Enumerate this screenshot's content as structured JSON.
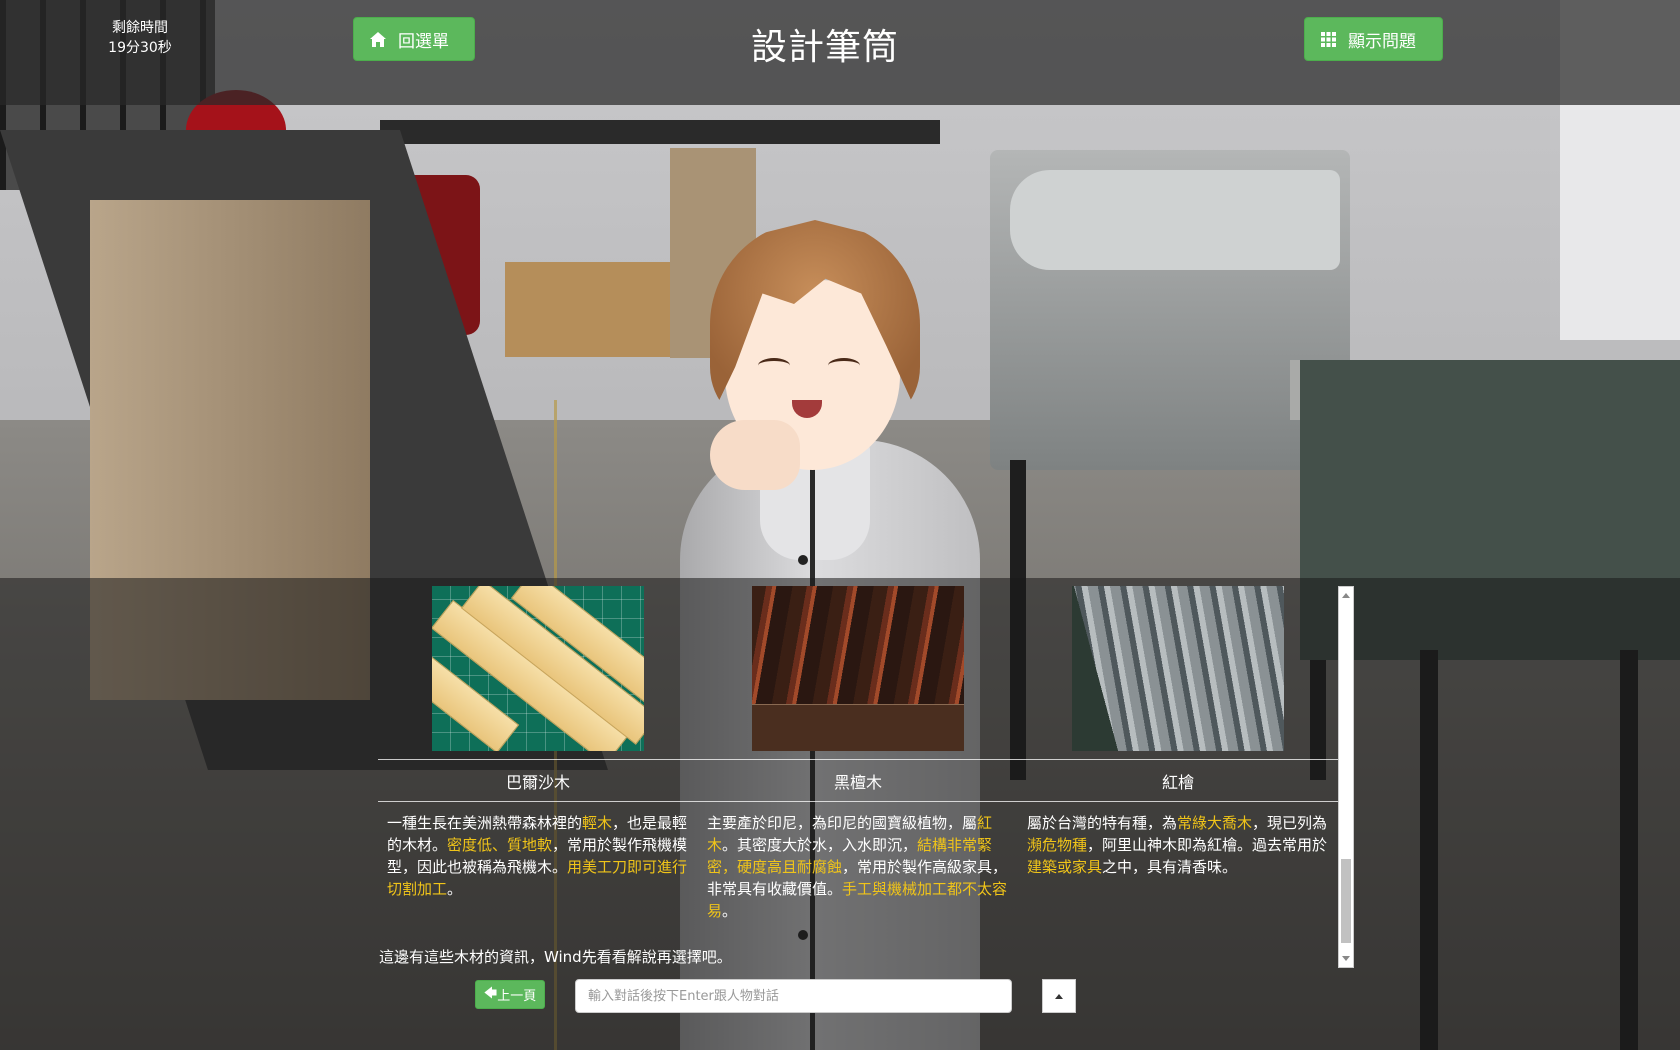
{
  "timer": {
    "label": "剩餘時間",
    "value": "19分30秒"
  },
  "nav": {
    "menu_label": "回選單",
    "show_questions_label": "顯示問題"
  },
  "page": {
    "title": "設計筆筒"
  },
  "woods": [
    {
      "name": "巴爾沙木",
      "desc_parts": [
        "一種生長在美洲熱帶森林裡的",
        "輕木",
        "，也是最輕的木材。",
        "密度低、質地軟",
        "，常用於製作飛機模型，因此也被稱為飛機木。",
        "用美工刀即可進行切割加工",
        "。"
      ]
    },
    {
      "name": "黑檀木",
      "desc_parts": [
        "主要產於印尼，為印尼的國寶級植物，屬",
        "紅木",
        "。其密度大於水，入水即沉，",
        "結構非常緊密，硬度高且耐腐蝕",
        "，常用於製作高級家具，非常具有收藏價值。",
        "手工與機械加工都不太容易",
        "。"
      ]
    },
    {
      "name": "紅檜",
      "desc_parts": [
        "屬於台灣的特有種，為",
        "常綠大喬木",
        "，現已列為",
        "瀕危物種",
        "，阿里山神木即為紅檜。過去常用於",
        "建築或家具",
        "之中，具有清香味。"
      ]
    }
  ],
  "dialog": {
    "narration": "這邊有這些木材的資訊，Wind先看看解說再選擇吧。"
  },
  "controls": {
    "prev_label": "上一頁",
    "input_placeholder": "輸入對話後按下Enter跟人物對話"
  },
  "colors": {
    "button_green": "#5cb85c",
    "highlight": "#f0c419"
  }
}
